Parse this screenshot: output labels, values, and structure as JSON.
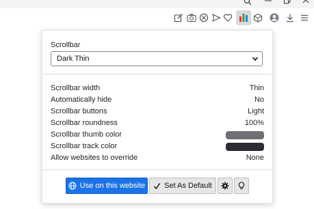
{
  "titlebar": {
    "search_icon": "search-icon",
    "minimize_icon": "minimize-icon",
    "restore_icon": "restore-icon",
    "close_icon": "close-icon"
  },
  "toolbar": {
    "icons": [
      "edit-icon",
      "camera-icon",
      "block-icon",
      "send-icon",
      "heart-icon",
      "scrollbar-extension-icon",
      "cube-icon",
      "profile-icon",
      "download-icon",
      "menu-icon"
    ]
  },
  "popup": {
    "scrollbar_label": "Scrollbar",
    "scrollbar_select_value": "Dark Thin",
    "settings": [
      {
        "label": "Scrollbar width",
        "value": "Thin"
      },
      {
        "label": "Automatically hide",
        "value": "No"
      },
      {
        "label": "Scrollbar buttons",
        "value": "Light"
      },
      {
        "label": "Scrollbar roundness",
        "value": "100%"
      },
      {
        "label": "Scrollbar thumb color",
        "color": "#6f7076"
      },
      {
        "label": "Scrollbar track color",
        "color": "#2b2c35"
      },
      {
        "label": "Allow websites to override",
        "value": "None"
      }
    ],
    "buttons": {
      "use_on_site": "Use on this website",
      "set_default": "Set As Default"
    }
  },
  "colors": {
    "accent": "#1a73e8",
    "active_extension_bg": "#d9dadc"
  }
}
